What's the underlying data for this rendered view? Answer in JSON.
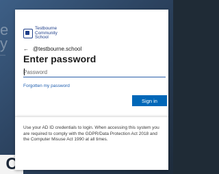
{
  "background": {
    "side_text_lines": [
      "e",
      "y",
      "—"
    ],
    "corner_letter": "C"
  },
  "brand": {
    "logo_lines": [
      "Testbourne",
      "Community",
      "School"
    ]
  },
  "login": {
    "identity": "@testbourne.school",
    "back_icon": "arrow-left-icon",
    "title": "Enter password",
    "password_placeholder": "Password",
    "forgot_link": "Forgotten my password",
    "signin_label": "Sign in"
  },
  "notice": {
    "text": "Use your AD ID credentials to login. When accessing this system you are required to comply with the GDPR/Data Protection Act 2018 and the Computer Misuse Act 1990 at all times."
  },
  "colors": {
    "accent": "#0067b8",
    "link": "#1f5fb0",
    "brand": "#1f3f8a"
  }
}
